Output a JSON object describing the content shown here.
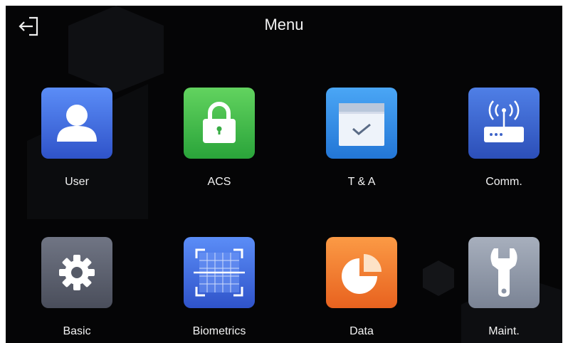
{
  "header": {
    "title": "Menu",
    "back_icon": "exit-arrow-icon"
  },
  "menu": {
    "items": [
      {
        "label": "User",
        "icon": "user-icon",
        "color": "#3f6fe0"
      },
      {
        "label": "ACS",
        "icon": "lock-icon",
        "color": "#3dbb45"
      },
      {
        "label": "T & A",
        "icon": "calendar-check-icon",
        "color": "#2f8fe8"
      },
      {
        "label": "Comm.",
        "icon": "router-icon",
        "color": "#3d63c8"
      },
      {
        "label": "Basic",
        "icon": "gear-icon",
        "color": "#5d6170"
      },
      {
        "label": "Biometrics",
        "icon": "face-scan-icon",
        "color": "#3f6fe0"
      },
      {
        "label": "Data",
        "icon": "pie-chart-icon",
        "color": "#f07a2e"
      },
      {
        "label": "Maint.",
        "icon": "wrench-icon",
        "color": "#8c95a6"
      }
    ]
  }
}
